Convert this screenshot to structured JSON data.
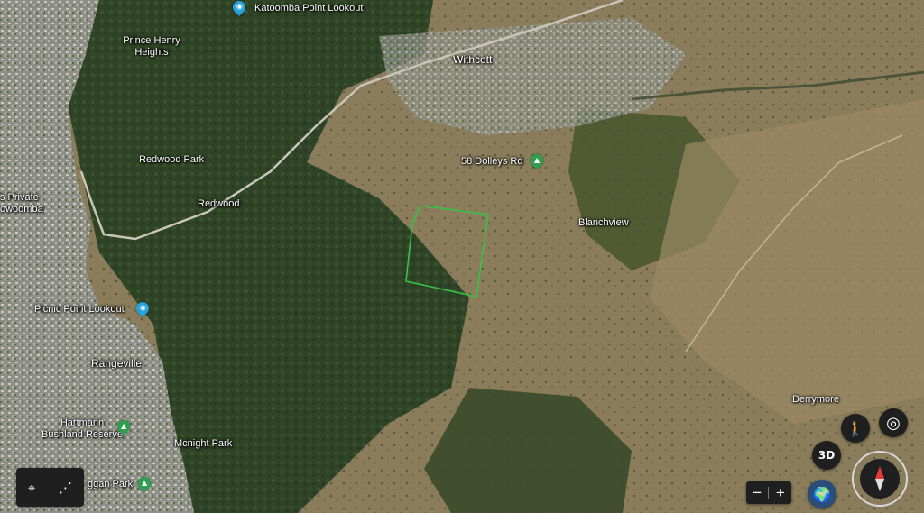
{
  "map": {
    "type": "satellite",
    "boundary_color": "#36c247",
    "road_color": "#c9c6b8"
  },
  "places": [
    {
      "id": "katoomba",
      "label": "Katoomba Point Lookout",
      "kind": "poi",
      "pin": "camera-pin-icon",
      "pin_color": "#26a3db"
    },
    {
      "id": "prince-henry",
      "label": "Prince Henry Heights",
      "kind": "suburb"
    },
    {
      "id": "withcott",
      "label": "Withcott",
      "kind": "town"
    },
    {
      "id": "redwood-park",
      "label": "Redwood Park",
      "kind": "park"
    },
    {
      "id": "redwood",
      "label": "Redwood",
      "kind": "suburb"
    },
    {
      "id": "private-twb",
      "label": "s Private owoomba",
      "kind": "poi-partial"
    },
    {
      "id": "dolleys",
      "label": "58 Dolleys Rd",
      "kind": "poi",
      "pin": "tree-pin-icon",
      "pin_color": "#2e9e4f"
    },
    {
      "id": "blanchview",
      "label": "Blanchview",
      "kind": "locality"
    },
    {
      "id": "picnic",
      "label": "Picnic Point Lookout",
      "kind": "poi",
      "pin": "camera-pin-icon",
      "pin_color": "#26a3db"
    },
    {
      "id": "rangeville",
      "label": "Rangeville",
      "kind": "suburb"
    },
    {
      "id": "hartmann",
      "label": "Hartmann Bushland Reserve",
      "kind": "park",
      "pin": "tree-pin-icon",
      "pin_color": "#2e9e4f"
    },
    {
      "id": "mcnight",
      "label": "Mcnight Park",
      "kind": "park"
    },
    {
      "id": "gan-park",
      "label": "ggan Park",
      "kind": "park-partial",
      "pin": "tree-pin-icon",
      "pin_color": "#2e9e4f"
    },
    {
      "id": "derrymore",
      "label": "Derrymore",
      "kind": "locality"
    }
  ],
  "controls": {
    "place_icon": "location-pin-icon",
    "measure_icon": "path-measure-icon",
    "three_d_label": "3D",
    "zoom_out": "−",
    "zoom_in": "+",
    "pegman_icon": "pegman-icon",
    "locate_icon": "my-location-icon",
    "globe_icon": "globe-icon",
    "compass_icon": "compass-icon"
  }
}
